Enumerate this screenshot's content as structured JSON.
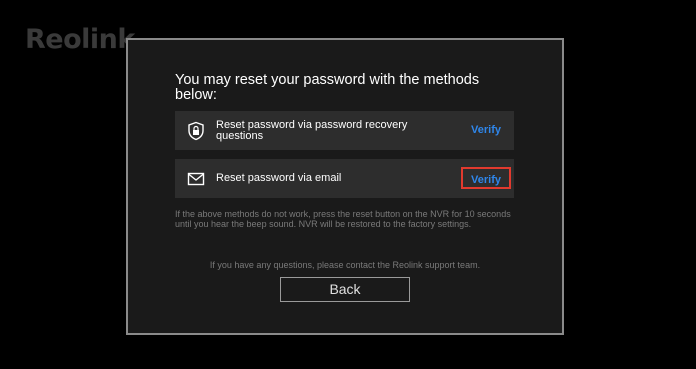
{
  "brand": {
    "logo_text": "Reolink"
  },
  "dialog": {
    "title": "You may reset your password with the methods below:",
    "methods": [
      {
        "icon": "lock-icon",
        "label": "Reset password via password recovery questions",
        "action_label": "Verify"
      },
      {
        "icon": "mail-icon",
        "label": "Reset password via email",
        "action_label": "Verify",
        "highlighted": true
      }
    ],
    "fallback_note": "If the above methods do not work, press the reset button on the NVR for 10 seconds until you hear the beep sound. NVR will be restored to the factory settings.",
    "contact_note": "If you have any questions, please contact the Reolink support team.",
    "back_label": "Back"
  },
  "colors": {
    "background": "#000000",
    "panel": "#1a1a1a",
    "row": "#2d2d2d",
    "accent": "#2f86ea",
    "highlight_border": "#e23a2e"
  }
}
